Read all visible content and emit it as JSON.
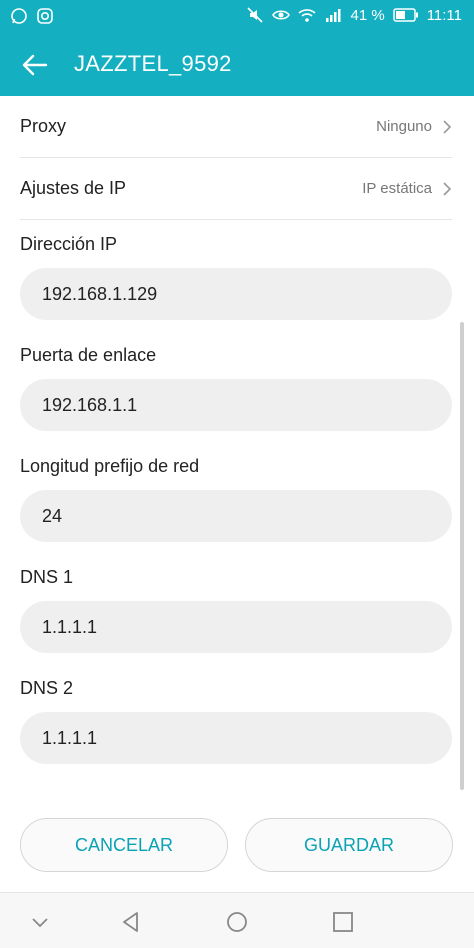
{
  "status": {
    "battery": "41 %",
    "time": "11:11"
  },
  "appbar": {
    "title": "JAZZTEL_9592"
  },
  "rows": [
    {
      "label": "Proxy",
      "value": "Ninguno"
    },
    {
      "label": "Ajustes de IP",
      "value": "IP estática"
    }
  ],
  "fields": [
    {
      "label": "Dirección IP",
      "value": "192.168.1.129"
    },
    {
      "label": "Puerta de enlace",
      "value": "192.168.1.1"
    },
    {
      "label": "Longitud prefijo de red",
      "value": "24"
    },
    {
      "label": "DNS 1",
      "value": "1.1.1.1"
    },
    {
      "label": "DNS 2",
      "value": "1.1.1.1"
    }
  ],
  "buttons": {
    "cancel": "CANCELAR",
    "save": "GUARDAR"
  },
  "icons": [
    "whatsapp-icon",
    "instagram-icon",
    "mute-icon",
    "eye-icon",
    "wifi-icon",
    "signal-icon",
    "battery-icon",
    "back-arrow-icon",
    "chevron-right-icon",
    "nav-collapse-icon",
    "nav-back-icon",
    "nav-home-icon",
    "nav-recents-icon"
  ],
  "colors": {
    "accent": "#14b0c2",
    "button_text": "#0aa2b5",
    "field_bg": "#efefef"
  }
}
